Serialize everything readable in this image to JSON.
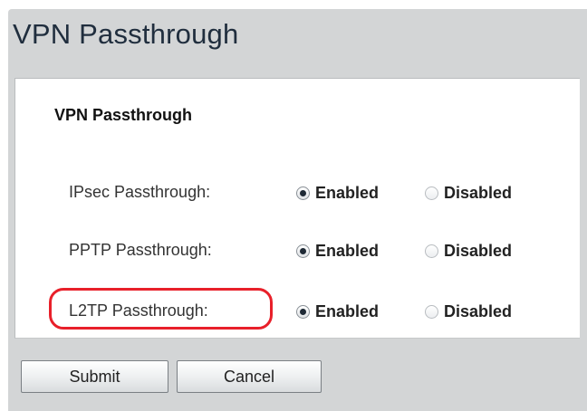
{
  "page": {
    "title": "VPN Passthrough"
  },
  "section": {
    "title": "VPN Passthrough"
  },
  "rows": [
    {
      "label": "IPsec Passthrough:",
      "selected": "Enabled",
      "options": [
        "Enabled",
        "Disabled"
      ]
    },
    {
      "label": "PPTP Passthrough:",
      "selected": "Enabled",
      "options": [
        "Enabled",
        "Disabled"
      ]
    },
    {
      "label": "L2TP Passthrough:",
      "selected": "Enabled",
      "options": [
        "Enabled",
        "Disabled"
      ]
    }
  ],
  "buttons": {
    "submit": "Submit",
    "cancel": "Cancel"
  },
  "colors": {
    "page_background": "#d3d5d6",
    "title_text": "#202e3e",
    "highlight": "#e8202a"
  }
}
